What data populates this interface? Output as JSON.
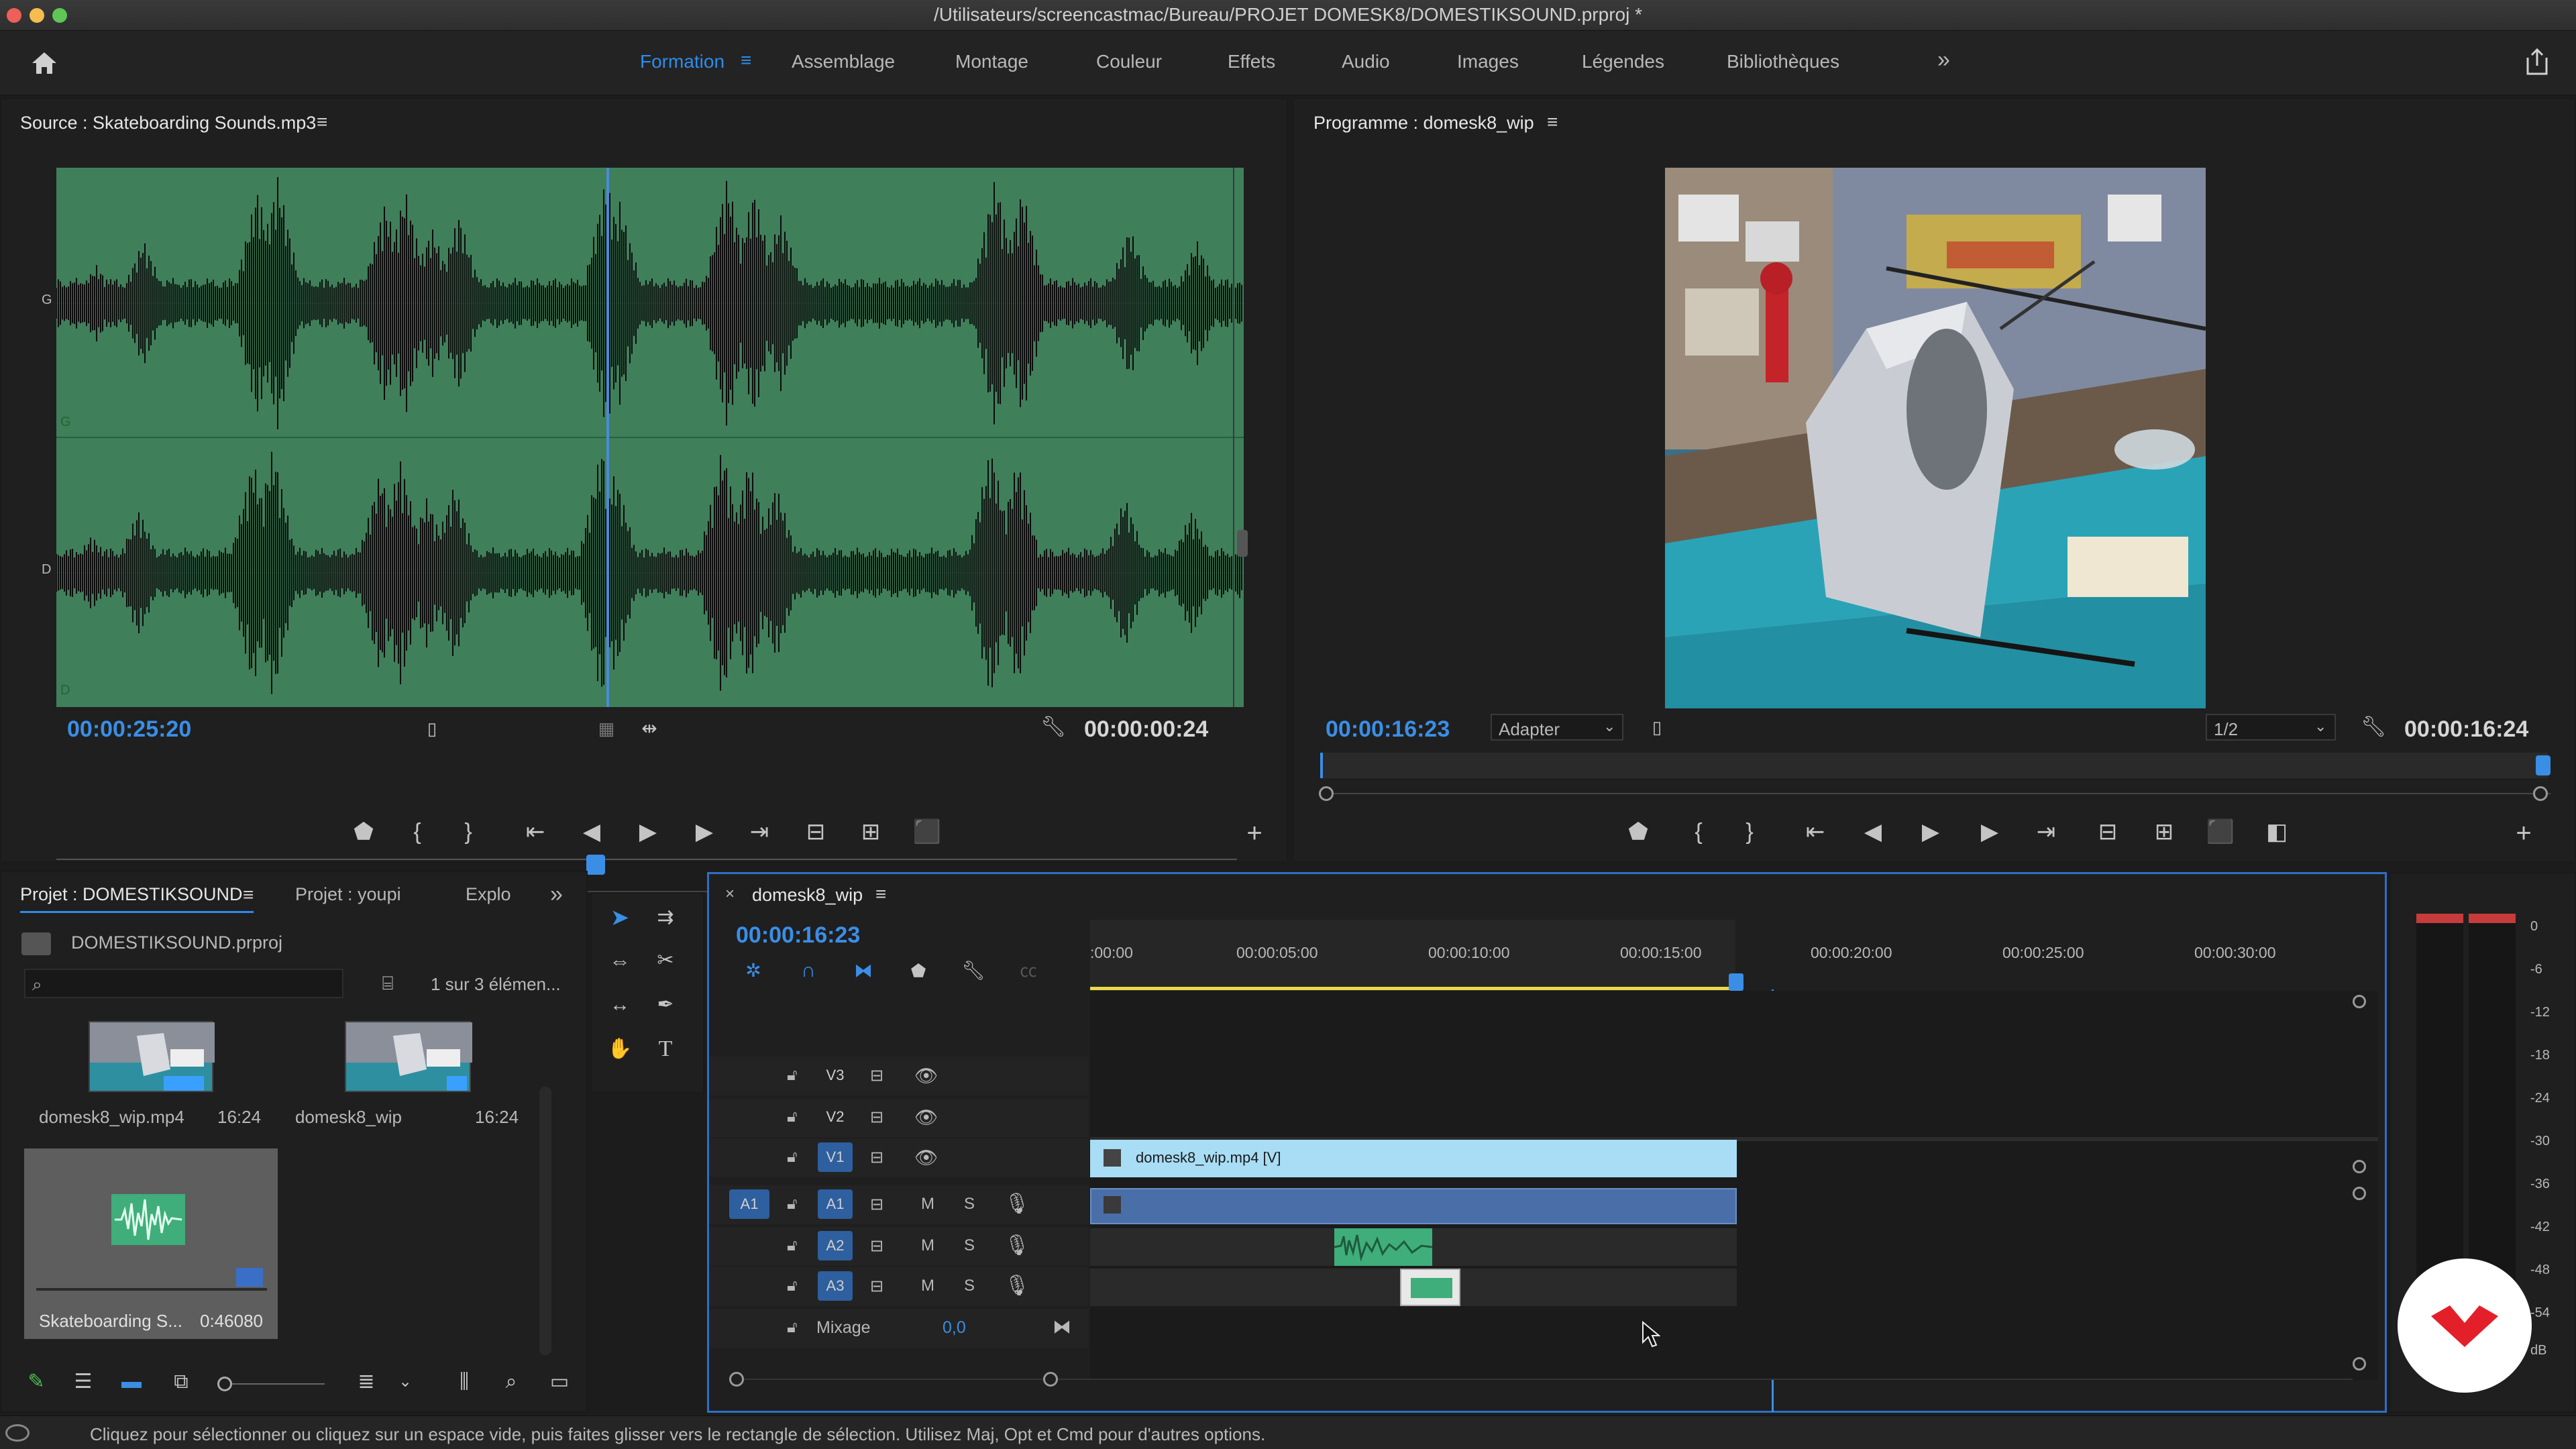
{
  "window": {
    "title": "/Utilisateurs/screencastmac/Bureau/PROJET DOMESK8/DOMESTIKSOUND.prproj *"
  },
  "workspaces": {
    "items": [
      "Formation",
      "Assemblage",
      "Montage",
      "Couleur",
      "Effets",
      "Audio",
      "Images",
      "Légendes",
      "Bibliothèques"
    ],
    "active": "Formation",
    "more": "»"
  },
  "source": {
    "title": "Source : Skateboarding Sounds.mp3",
    "timecode": "00:00:25:20",
    "duration": "00:00:00:24",
    "channel_labels": [
      "G",
      "G",
      "D",
      "D"
    ],
    "waveform_color": "#3f7f5a"
  },
  "program": {
    "title": "Programme : domesk8_wip",
    "timecode": "00:00:16:23",
    "fit": "Adapter",
    "resolution": "1/2",
    "duration": "00:00:16:24"
  },
  "project": {
    "tabs": [
      "Projet : DOMESTIKSOUND",
      "Projet : youpi",
      "Explo"
    ],
    "file": "DOMESTIKSOUND.prproj",
    "count": "1 sur 3 élémen...",
    "search_placeholder": "",
    "items": [
      {
        "name": "domesk8_wip.mp4",
        "duration": "16:24"
      },
      {
        "name": "domesk8_wip",
        "duration": "16:24"
      },
      {
        "name": "Skateboarding S...",
        "duration": "0:46080"
      }
    ]
  },
  "timeline": {
    "tab": "domesk8_wip",
    "timecode": "00:00:16:23",
    "ruler": [
      ":00:00",
      "00:00:05:00",
      "00:00:10:00",
      "00:00:15:00",
      "00:00:20:00",
      "00:00:25:00",
      "00:00:30:00"
    ],
    "tracks_video": [
      "V3",
      "V2",
      "V1"
    ],
    "tracks_audio": [
      "A1",
      "A2",
      "A3"
    ],
    "source_patch": "A1",
    "mix_label": "Mixage",
    "mix_value": "0,0",
    "clip_v1": "domesk8_wip.mp4 [V]",
    "clip_color": "#a8ddf5"
  },
  "meter": {
    "scale": [
      "0",
      "-6",
      "-12",
      "-18",
      "-24",
      "-30",
      "-36",
      "-42",
      "-48",
      "-54",
      "dB"
    ]
  },
  "status": {
    "text": "Cliquez pour sélectionner ou cliquez sur un espace vide, puis faites glisser vers le rectangle de sélection. Utilisez Maj, Opt et Cmd pour d'autres options."
  },
  "track_buttons": {
    "m": "M",
    "s": "S"
  },
  "colors": {
    "accent": "#2d8ceb",
    "audio_clip": "#3fae7a"
  }
}
